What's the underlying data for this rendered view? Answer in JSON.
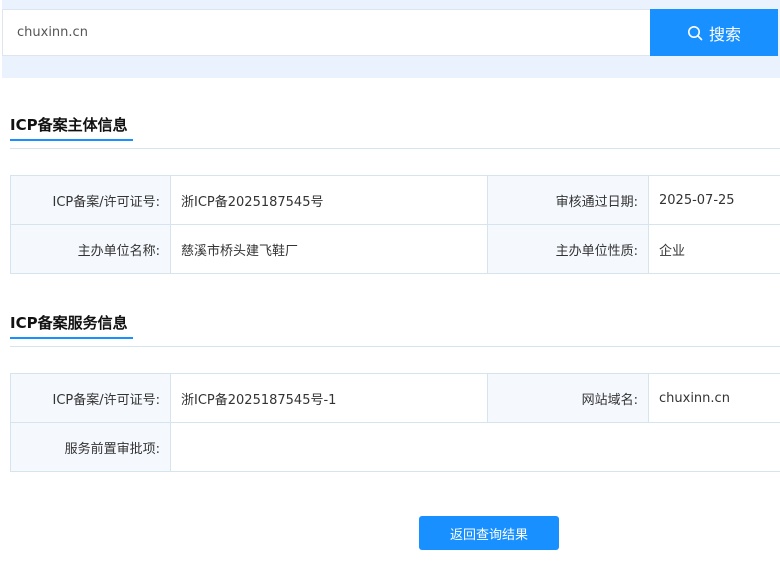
{
  "search": {
    "value": "chuxinn.cn",
    "button_label": "搜索"
  },
  "subject_section": {
    "title": "ICP备案主体信息",
    "rows": [
      {
        "label1": "ICP备案/许可证号:",
        "value1": "浙ICP备2025187545号",
        "label2": "审核通过日期:",
        "value2": "2025-07-25"
      },
      {
        "label1": "主办单位名称:",
        "value1": "慈溪市桥头建飞鞋厂",
        "label2": "主办单位性质:",
        "value2": "企业"
      }
    ]
  },
  "service_section": {
    "title": "ICP备案服务信息",
    "row1": {
      "label1": "ICP备案/许可证号:",
      "value1": "浙ICP备2025187545号-1",
      "label2": "网站域名:",
      "value2": "chuxinn.cn"
    },
    "row2": {
      "label1": "服务前置审批项:",
      "value1": ""
    }
  },
  "back_button_label": "返回查询结果",
  "colors": {
    "accent": "#1890ff",
    "label_bg": "#f5f9fd",
    "search_bg": "#eaf3fd"
  }
}
